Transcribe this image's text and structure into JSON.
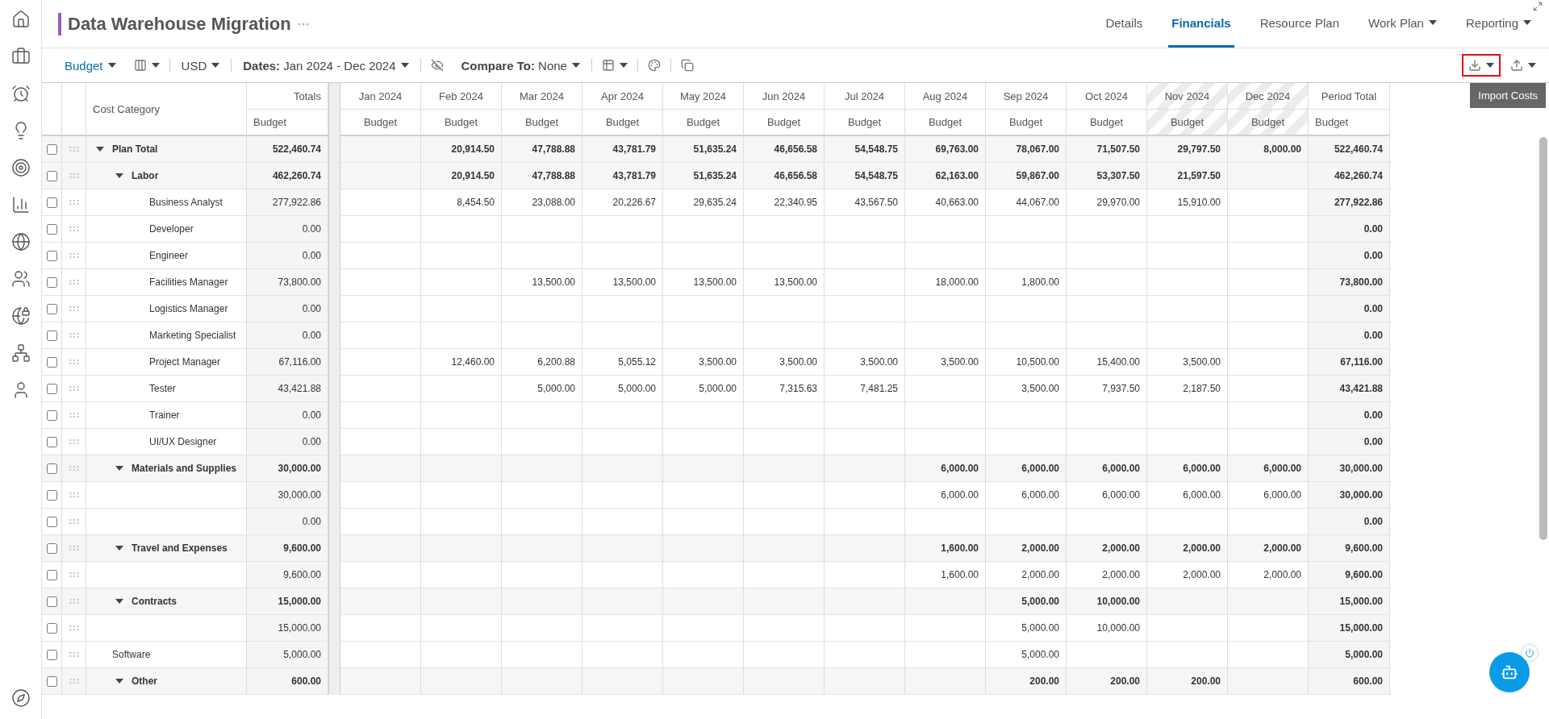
{
  "header": {
    "title": "Data Warehouse Migration",
    "tabs": [
      {
        "label": "Details",
        "selected": false,
        "has_menu": false
      },
      {
        "label": "Financials",
        "selected": true,
        "has_menu": false
      },
      {
        "label": "Resource Plan",
        "selected": false,
        "has_menu": false
      },
      {
        "label": "Work Plan",
        "selected": false,
        "has_menu": true
      },
      {
        "label": "Reporting",
        "selected": false,
        "has_menu": true
      }
    ]
  },
  "toolbar": {
    "view": "Budget",
    "currency": "USD",
    "dates": "**Dates:** Jan 2024 - Dec 2024",
    "compare": "**Compare To:** None",
    "import_highlighted": true,
    "tooltip": "Import Costs"
  },
  "table": {
    "category_header": "Cost Category",
    "totals_header": "Totals",
    "totals_sub": "Budget",
    "months": [
      {
        "label": "Jan 2024",
        "sub": "Budget",
        "locked": false
      },
      {
        "label": "Feb 2024",
        "sub": "Budget",
        "locked": false
      },
      {
        "label": "Mar 2024",
        "sub": "Budget",
        "locked": false
      },
      {
        "label": "Apr 2024",
        "sub": "Budget",
        "locked": false
      },
      {
        "label": "May 2024",
        "sub": "Budget",
        "locked": false
      },
      {
        "label": "Jun 2024",
        "sub": "Budget",
        "locked": false
      },
      {
        "label": "Jul 2024",
        "sub": "Budget",
        "locked": false
      },
      {
        "label": "Aug 2024",
        "sub": "Budget",
        "locked": false
      },
      {
        "label": "Sep 2024",
        "sub": "Budget",
        "locked": false
      },
      {
        "label": "Oct 2024",
        "sub": "Budget",
        "locked": false
      },
      {
        "label": "Nov 2024",
        "sub": "Budget",
        "locked": true
      },
      {
        "label": "Dec 2024",
        "sub": "Budget",
        "locked": true
      }
    ],
    "period_total_header": "Period Total",
    "period_total_sub": "Budget",
    "rows": [
      {
        "kind": "group",
        "name": "Plan Total",
        "checked": false,
        "expanded": true,
        "total": "522,460.74",
        "values": {
          "feb": "20,914.50",
          "mar": "47,788.88",
          "apr": "43,781.79",
          "may": "51,635.24",
          "jun": "46,656.58",
          "jul": "54,548.75",
          "aug": "69,763.00",
          "sep": "78,067.00",
          "oct": "71,507.50",
          "nov": "29,797.50",
          "dec": "8,000.00"
        },
        "period_total": "522,460.74",
        "children": [
          {
            "kind": "group",
            "name": "Labor",
            "checked": false,
            "expanded": true,
            "total": "462,260.74",
            "values": {
              "feb": "20,914.50",
              "mar": "47,788.88",
              "apr": "43,781.79",
              "may": "51,635.24",
              "jun": "46,656.58",
              "jul": "54,548.75",
              "aug": "62,163.00",
              "sep": "59,867.00",
              "oct": "53,307.50",
              "nov": "21,597.50"
            },
            "period_total": "462,260.74",
            "children": [
              {
                "kind": "item",
                "name": "Business Analyst",
                "checked": false,
                "total": "277,922.86",
                "values": {
                  "feb": "8,454.50",
                  "mar": "23,088.00",
                  "apr": "20,226.67",
                  "may": "29,635.24",
                  "jun": "22,340.95",
                  "jul": "43,567.50",
                  "aug": "40,663.00",
                  "sep": "44,067.00",
                  "oct": "29,970.00",
                  "nov": "15,910.00"
                },
                "period_total": "277,922.86"
              },
              {
                "kind": "item",
                "name": "Developer",
                "checked": false,
                "total": "0.00",
                "period_total": "0.00"
              },
              {
                "kind": "item",
                "name": "Engineer",
                "checked": false,
                "total": "0.00",
                "period_total": "0.00"
              },
              {
                "kind": "item",
                "name": "Facilities Manager",
                "checked": false,
                "total": "73,800.00",
                "values": {
                  "mar": "13,500.00",
                  "apr": "13,500.00",
                  "may": "13,500.00",
                  "jun": "13,500.00",
                  "aug": "18,000.00",
                  "sep": "1,800.00"
                },
                "period_total": "73,800.00"
              },
              {
                "kind": "item",
                "name": "Logistics Manager",
                "checked": false,
                "total": "0.00",
                "period_total": "0.00"
              },
              {
                "kind": "item",
                "name": "Marketing Specialist",
                "checked": false,
                "total": "0.00",
                "period_total": "0.00"
              },
              {
                "kind": "item",
                "name": "Project Manager",
                "checked": false,
                "total": "67,116.00",
                "values": {
                  "feb": "12,460.00",
                  "mar": "6,200.88",
                  "apr": "5,055.12",
                  "may": "3,500.00",
                  "jun": "3,500.00",
                  "jul": "3,500.00",
                  "aug": "3,500.00",
                  "sep": "10,500.00",
                  "oct": "15,400.00",
                  "nov": "3,500.00"
                },
                "period_total": "67,116.00"
              },
              {
                "kind": "item",
                "name": "Tester",
                "checked": false,
                "total": "43,421.88",
                "values": {
                  "mar": "5,000.00",
                  "apr": "5,000.00",
                  "may": "5,000.00",
                  "jun": "7,315.63",
                  "jul": "7,481.25",
                  "sep": "3,500.00",
                  "oct": "7,937.50",
                  "nov": "2,187.50"
                },
                "period_total": "43,421.88"
              },
              {
                "kind": "item",
                "name": "Trainer",
                "checked": false,
                "total": "0.00",
                "period_total": "0.00"
              },
              {
                "kind": "item",
                "name": "UI/UX Designer",
                "checked": false,
                "total": "0.00",
                "period_total": "0.00"
              }
            ]
          },
          {
            "kind": "group",
            "name": "Materials and Supplies",
            "checked": false,
            "expanded": true,
            "total": "30,000.00",
            "values": {
              "aug": "6,000.00",
              "sep": "6,000.00",
              "oct": "6,000.00",
              "nov": "6,000.00",
              "dec": "6,000.00"
            },
            "period_total": "30,000.00",
            "children": [
              {
                "kind": "item",
                "checked": false,
                "total": "30,000.00",
                "values": {
                  "aug": "6,000.00",
                  "sep": "6,000.00",
                  "oct": "6,000.00",
                  "nov": "6,000.00",
                  "dec": "6,000.00"
                },
                "period_total": "30,000.00"
              },
              {
                "kind": "item",
                "checked": false,
                "total": "0.00",
                "period_total": "0.00"
              }
            ]
          },
          {
            "kind": "group",
            "name": "Travel and Expenses",
            "checked": false,
            "expanded": true,
            "total": "9,600.00",
            "values": {
              "aug": "1,600.00",
              "sep": "2,000.00",
              "oct": "2,000.00",
              "nov": "2,000.00",
              "dec": "2,000.00"
            },
            "period_total": "9,600.00",
            "children": [
              {
                "kind": "item",
                "checked": false,
                "total": "9,600.00",
                "values": {
                  "aug": "1,600.00",
                  "sep": "2,000.00",
                  "oct": "2,000.00",
                  "nov": "2,000.00",
                  "dec": "2,000.00"
                },
                "period_total": "9,600.00"
              }
            ]
          },
          {
            "kind": "group",
            "name": "Contracts",
            "checked": false,
            "expanded": true,
            "total": "15,000.00",
            "values": {
              "sep": "5,000.00",
              "oct": "10,000.00"
            },
            "period_total": "15,000.00",
            "children": [
              {
                "kind": "item",
                "checked": false,
                "total": "15,000.00",
                "values": {
                  "sep": "5,000.00",
                  "oct": "10,000.00"
                },
                "period_total": "15,000.00"
              },
              {
                "kind": "flush",
                "name": "Software",
                "checked": false,
                "total": "5,000.00",
                "values": {
                  "sep": "5,000.00"
                },
                "period_total": "5,000.00"
              }
            ]
          },
          {
            "kind": "group",
            "name": "Other",
            "checked": false,
            "expanded": true,
            "total": "600.00",
            "values": {
              "sep": "200.00",
              "oct": "200.00",
              "nov": "200.00"
            },
            "period_total": "600.00"
          }
        ]
      }
    ]
  }
}
